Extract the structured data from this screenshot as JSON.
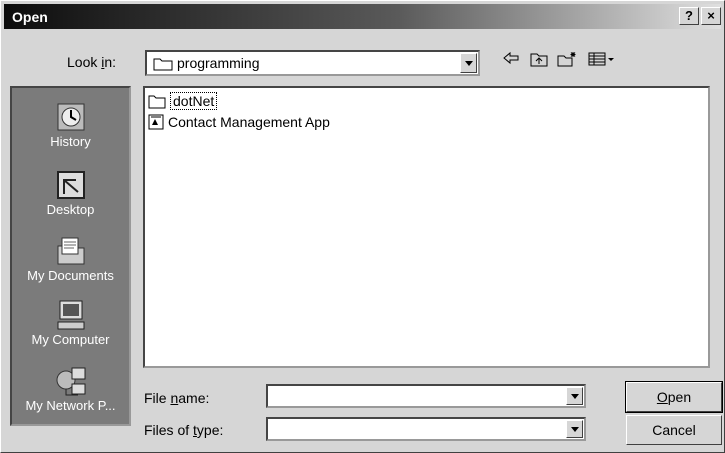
{
  "window": {
    "title": "Open",
    "help_label": "?",
    "close_label": "×"
  },
  "look_in": {
    "label_prefix": "Look ",
    "label_mnemonic": "i",
    "label_suffix": "n:",
    "value": "programming"
  },
  "toolbar": [
    "back-icon",
    "up-folder-icon",
    "new-folder-icon",
    "view-menu-icon"
  ],
  "places": [
    {
      "label": "History",
      "icon": "history-icon"
    },
    {
      "label": "Desktop",
      "icon": "desktop-icon"
    },
    {
      "label": "My Documents",
      "icon": "documents-icon"
    },
    {
      "label": "My Computer",
      "icon": "computer-icon"
    },
    {
      "label": "My Network P...",
      "icon": "network-icon"
    }
  ],
  "files": [
    {
      "name": "dotNet",
      "type": "folder"
    },
    {
      "name": "Contact Management App",
      "type": "document"
    }
  ],
  "file_name": {
    "label_prefix": "File ",
    "label_mnemonic": "n",
    "label_suffix": "ame:",
    "value": ""
  },
  "files_of_type": {
    "label_prefix": "Files of ",
    "label_mnemonic": "t",
    "label_suffix": "ype:",
    "value": ""
  },
  "buttons": {
    "open_mnemonic": "O",
    "open_rest": "pen",
    "cancel": "Cancel"
  }
}
